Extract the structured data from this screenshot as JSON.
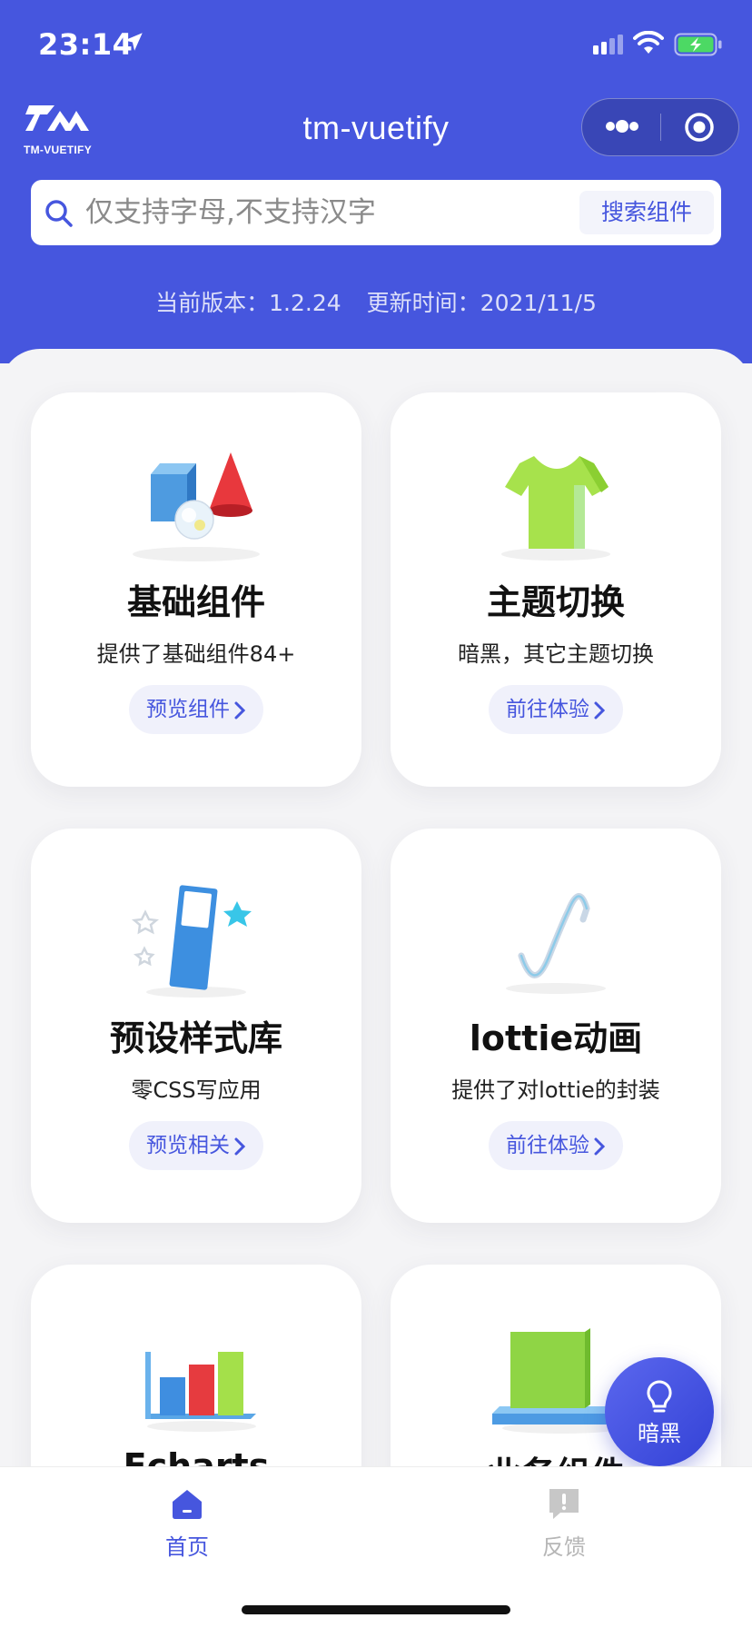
{
  "status_bar": {
    "time": "23:14",
    "icons": [
      "location-arrow-icon",
      "signal-icon",
      "wifi-icon",
      "battery-charging-icon"
    ],
    "battery_color": "#4cd964"
  },
  "nav": {
    "logo_text": "TM-VUETIFY",
    "title": "tm-vuetify",
    "capsule_icons": [
      "more-dots-icon",
      "close-circle-icon"
    ]
  },
  "search": {
    "placeholder": "仅支持字母,不支持汉字",
    "value": "",
    "button_label": "搜索组件"
  },
  "version": {
    "version_text": "当前版本：1.2.24",
    "updated_text": "更新时间：2021/11/5"
  },
  "cards": [
    {
      "title": "基础组件",
      "desc": "提供了基础组件84+",
      "button": "预览组件",
      "icon": "shapes-icon"
    },
    {
      "title": "主题切换",
      "desc": "暗黑，其它主题切换",
      "button": "前往体验",
      "icon": "tshirt-icon"
    },
    {
      "title": "预设样式库",
      "desc": "零CSS写应用",
      "button": "预览相关",
      "icon": "style-panel-icon"
    },
    {
      "title": "lottie动画",
      "desc": "提供了对lottie的封装",
      "button": "前往体验",
      "icon": "wave-curve-icon"
    },
    {
      "title": "Echarts",
      "desc": "",
      "button": "",
      "icon": "bar-chart-icon"
    },
    {
      "title": "业务组件",
      "desc": "",
      "button": "",
      "icon": "business-block-icon"
    }
  ],
  "fab": {
    "label": "暗黑",
    "icon": "lightbulb-icon"
  },
  "tabs": [
    {
      "label": "首页",
      "icon": "home-icon",
      "active": true
    },
    {
      "label": "反馈",
      "icon": "feedback-icon",
      "active": false
    }
  ],
  "colors": {
    "primary": "#4656de",
    "background": "#f4f4f6",
    "tab_inactive": "#b6b6b6"
  }
}
